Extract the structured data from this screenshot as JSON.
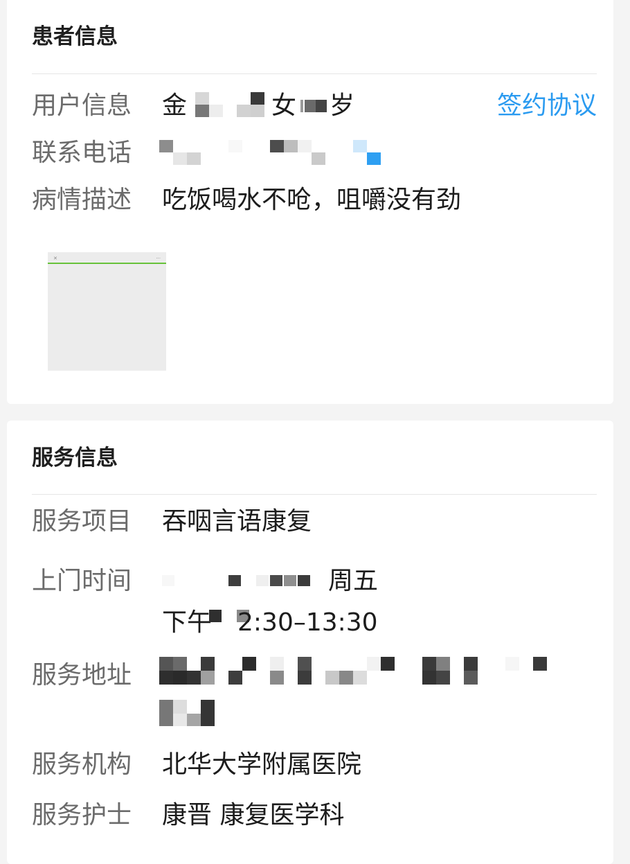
{
  "patient_card": {
    "title": "患者信息",
    "user_info": {
      "label": "用户信息",
      "name_visible": "金",
      "gender": "女",
      "age_suffix": "岁",
      "sign_link": "签约协议"
    },
    "contact": {
      "label": "联系电话"
    },
    "description": {
      "label": "病情描述",
      "value": "吃饭喝水不呛，咀嚼没有劲"
    },
    "attachment": {
      "icon": "image-thumbnail-icon"
    }
  },
  "service_card": {
    "title": "服务信息",
    "item": {
      "label": "服务项目",
      "value": "吞咽言语康复"
    },
    "visit_time": {
      "label": "上门时间",
      "weekday": "周五",
      "period_prefix": "下午",
      "time_range": "2:30–13:30"
    },
    "address": {
      "label": "服务地址"
    },
    "institution": {
      "label": "服务机构",
      "value": "北华大学附属医院"
    },
    "nurse": {
      "label": "服务护士",
      "value": "康晋 康复医学科"
    }
  },
  "colors": {
    "link": "#2b9bf0",
    "label": "#6b6b6b",
    "value": "#1c1c1c",
    "background": "#f4f4f4"
  }
}
